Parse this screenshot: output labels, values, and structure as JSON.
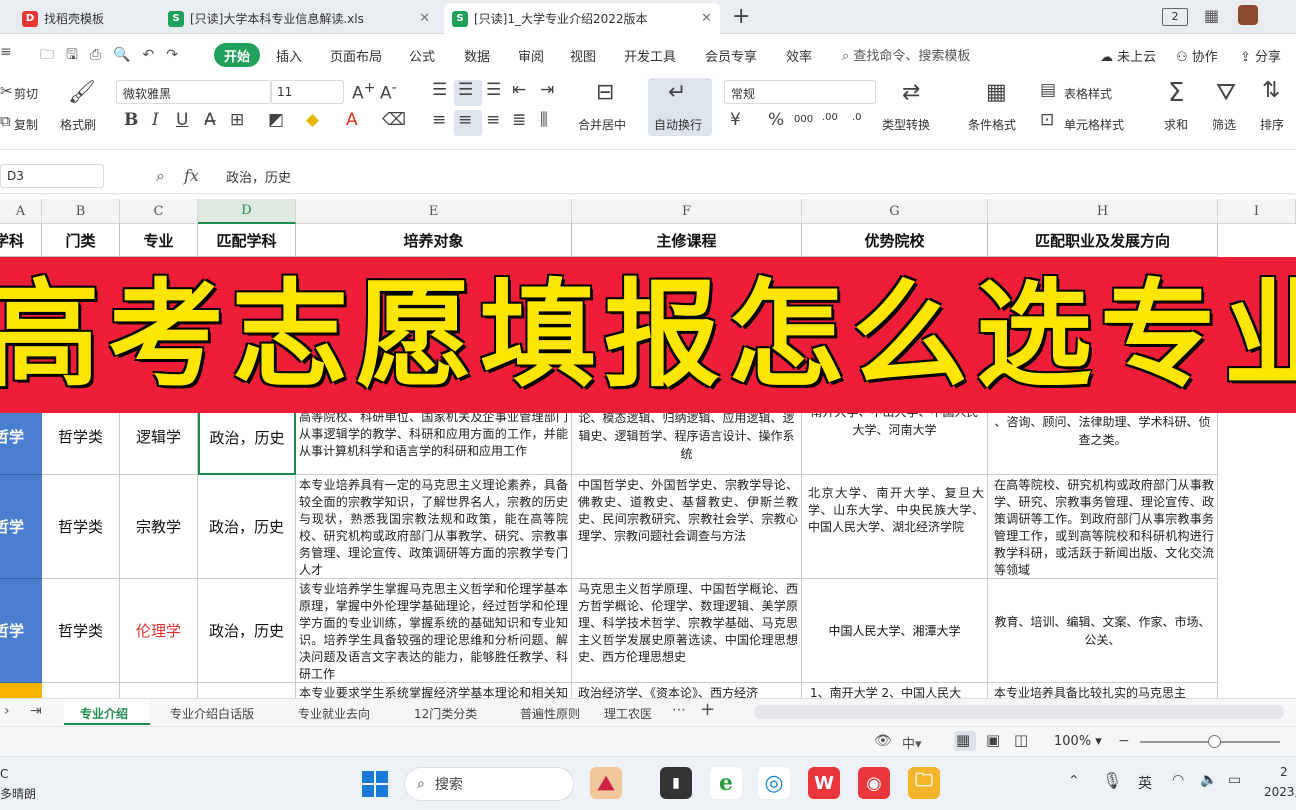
{
  "tabs": [
    {
      "label": "找稻壳模板",
      "icon": "D"
    },
    {
      "label": "[只读]大学本科专业信息解读.xls",
      "icon": "S"
    },
    {
      "label": "[只读]1_大学专业介绍2022版本",
      "icon": "S"
    }
  ],
  "title_buttons": {
    "new_tab": "+",
    "window_count": "2"
  },
  "menu": {
    "start": "开始",
    "items": [
      "插入",
      "页面布局",
      "公式",
      "数据",
      "审阅",
      "视图",
      "开发工具",
      "会员专享",
      "效率"
    ],
    "search": "查找命令、搜索模板",
    "cloud": "未上云",
    "collab": "协作",
    "share": "分享"
  },
  "ribbon": {
    "cut": "剪切",
    "copy": "复制",
    "format_painter": "格式刷",
    "font_name": "微软雅黑",
    "font_size": "11",
    "merge": "合并居中",
    "wrap": "自动换行",
    "number_format": "常规",
    "type_convert": "类型转换",
    "cond_format": "条件格式",
    "table_style": "表格样式",
    "cell_style": "单元格样式",
    "sum": "求和",
    "filter": "筛选",
    "sort": "排序"
  },
  "formula_bar": {
    "cell_ref": "D3",
    "fx": "fx",
    "content": "政治，历史"
  },
  "columns": [
    "A",
    "B",
    "C",
    "D",
    "E",
    "F",
    "G",
    "H",
    "I"
  ],
  "headers": [
    "学科",
    "门类",
    "专业",
    "匹配学科",
    "培养对象",
    "主修课程",
    "优势院校",
    "匹配职业及发展方向"
  ],
  "banner": "高考志愿填报怎么选专业",
  "rows": [
    {
      "a": "哲学",
      "b": "哲学类",
      "c": "逻辑学",
      "d": "政治，历史",
      "e": "高等院校、科研单位、国家机关及企事业管理部门从事逻辑学的教学、科研和应用方面的工作，并能从事计算机科学和语言学的科研和应用工作",
      "f": "论、模态逻辑、归纳逻辑、应用逻辑、逻辑史、逻辑哲学、程序语言设计、操作系统",
      "g": "南开大学、中山大学、中国人民大学、河南大学",
      "h": "、咨询、顾问、法律助理、学术科研、侦查之类。",
      "c_color": "#111"
    },
    {
      "a": "哲学",
      "b": "哲学类",
      "c": "宗教学",
      "d": "政治，历史",
      "e": "本专业培养具有一定的马克思主义理论素养，具备较全面的宗教学知识，了解世界名人，宗教的历史与现状，熟悉我国宗教法规和政策，能在高等院校、研究机构或政府部门从事教学、研究、宗教事务管理、理论宣传、政策调研等方面的宗教学专门人才",
      "f": "中国哲学史、外国哲学史、宗教学导论、佛教史、道教史、基督教史、伊斯兰教史、民间宗教研究、宗教社会学、宗教心理学、宗教问题社会调查与方法",
      "g": "北京大学、南开大学、复旦大学、山东大学、中央民族大学、中国人民大学、湖北经济学院",
      "h": "在高等院校、研究机构或政府部门从事教学、研究、宗教事务管理、理论宣传、政策调研等工作。到政府部门从事宗教事务管理工作，或到高等院校和科研机构进行教学科研，或活跃于新闻出版、文化交流等领域",
      "c_color": "#111"
    },
    {
      "a": "哲学",
      "b": "哲学类",
      "c": "伦理学",
      "d": "政治，历史",
      "e": "该专业培养学生掌握马克思主义哲学和伦理学基本原理，掌握中外伦理学基础理论，经过哲学和伦理学方面的专业训练，掌握系统的基础知识和专业知识。培养学生具备较强的理论思维和分析问题、解决问题及语言文字表达的能力，能够胜任教学、科研工作",
      "f": "马克思主义哲学原理、中国哲学概论、西方哲学概论、伦理学、数理逻辑、美学原理、科学技术哲学、宗教学基础、马克思主义哲学发展史原著选读、中国伦理思想史、西方伦理思想史",
      "g": "中国人民大学、湘潭大学",
      "h": "教育、培训、编辑、文案、作家、市场、公关、",
      "c_color": "#e03030"
    },
    {
      "a": "",
      "b": "",
      "c": "",
      "d": "",
      "e": "本专业要求学生系统掌握经济学基本理论和相关知识",
      "f": "政治经济学、《资本论》、西方经济",
      "g": "1、南开大学 2、中国人民大",
      "h": "本专业培养具备比较扎实的马克思主",
      "c_color": "#111"
    }
  ],
  "sheet_tabs": [
    "专业介绍",
    "专业介绍白话版",
    "专业就业去向",
    "12门类分类",
    "普遍性原则",
    "理工农医"
  ],
  "status": {
    "zoom": "100%",
    "lang": "中"
  },
  "taskbar": {
    "search": "搜索",
    "weather_line1": "C",
    "weather_line2": "多晴朗",
    "ime": "英",
    "clock_time": "2",
    "clock_date": "2023,"
  }
}
